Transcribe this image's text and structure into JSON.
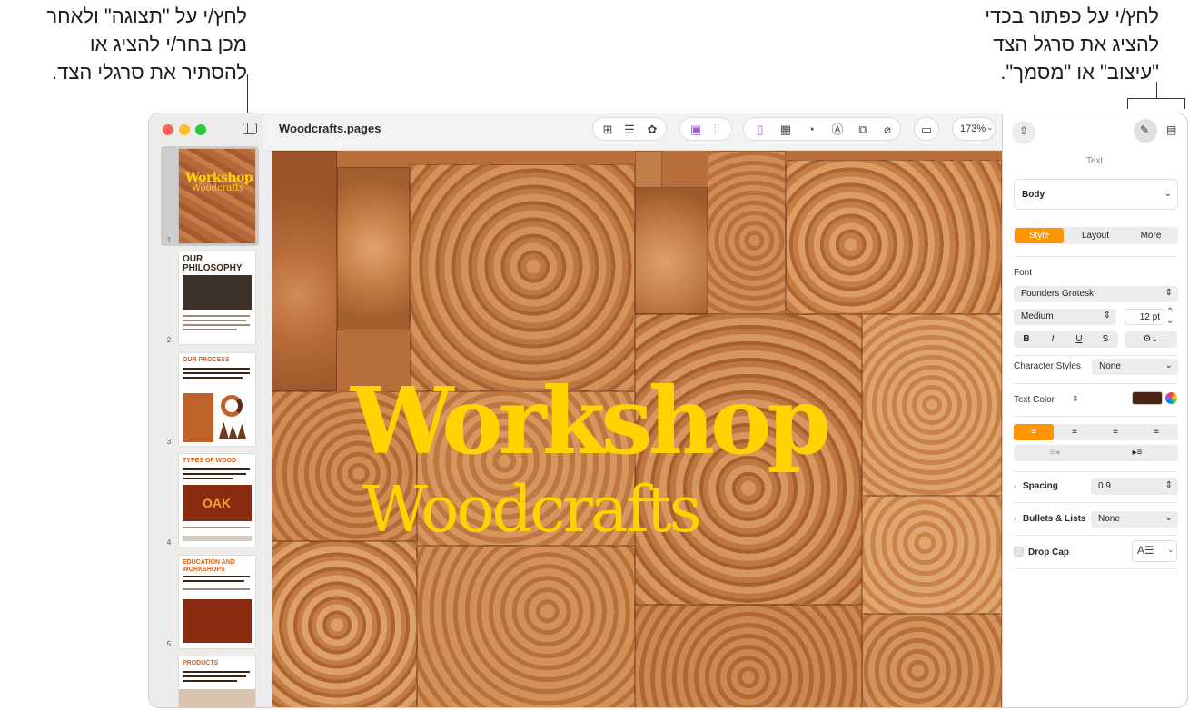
{
  "callouts": {
    "left": "לחץ/י על \"תצוגה\" ולאחר\nמכן בחר/י להציג או\nלהסתיר את סרגלי הצד.",
    "right": "לחץ/י על כפתור בכדי\nלהציג את סרגל הצד\n\"עיצוב\" או \"מסמך\"."
  },
  "window": {
    "title": "Woodcrafts.pages",
    "zoom": "173%"
  },
  "cover": {
    "title": "Workshop",
    "subtitle": "Woodcrafts"
  },
  "thumbnails": [
    {
      "num": "1",
      "title": "Workshop",
      "subtitle": "Woodcrafts",
      "selected": true
    },
    {
      "num": "2",
      "title": "OUR\nPHILOSOPHY"
    },
    {
      "num": "3",
      "title": "OUR PROCESS"
    },
    {
      "num": "4",
      "title": "TYPES OF WOOD",
      "label": "OAK"
    },
    {
      "num": "5",
      "title": "EDUCATION AND\nWORKSHOPS"
    },
    {
      "num": "",
      "title": "PRODUCTS"
    }
  ],
  "inspector": {
    "header": "Text",
    "paragraph_style": "Body",
    "tabs": [
      "Style",
      "Layout",
      "More"
    ],
    "font_label": "Font",
    "font_family": "Founders Grotesk",
    "font_weight": "Medium",
    "font_size": "12 pt",
    "format_buttons": [
      "B",
      "I",
      "U",
      "S"
    ],
    "char_styles_label": "Character Styles",
    "char_styles_value": "None",
    "text_color_label": "Text Color",
    "text_color": "#4a2414",
    "spacing_label": "Spacing",
    "spacing_value": "0.9",
    "bullets_label": "Bullets & Lists",
    "bullets_value": "None",
    "dropcap_label": "Drop Cap"
  },
  "colors": {
    "accent": "#ff9500",
    "cover_text": "#ffd200"
  }
}
